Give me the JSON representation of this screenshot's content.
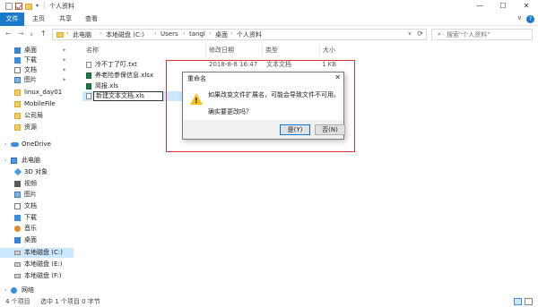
{
  "window": {
    "title": "个人资料",
    "title_sep": "|",
    "controls": {
      "minimize": "—",
      "maximize": "☐",
      "close": "✕"
    }
  },
  "ribbon": {
    "tabs": [
      "文件",
      "主页",
      "共享",
      "查看"
    ],
    "expand": "∨"
  },
  "nav": {
    "back": "←",
    "forward": "→",
    "recent": "∨",
    "up": "↑"
  },
  "address": {
    "crumbs": [
      "此电脑",
      "本地磁盘 (C:)",
      "Users",
      "tangl",
      "桌面",
      "个人资料"
    ],
    "sep": "›",
    "dropdown": "∨",
    "refresh": "⟳"
  },
  "search": {
    "icon": "⌕",
    "placeholder": "搜索\"个人资料\""
  },
  "sidebar": {
    "items": [
      {
        "label": "桌面",
        "icon": "desktop-icon",
        "pinned": true
      },
      {
        "label": "下载",
        "icon": "download-icon",
        "pinned": true
      },
      {
        "label": "文档",
        "icon": "document-icon",
        "pinned": true
      },
      {
        "label": "图片",
        "icon": "picture-icon",
        "pinned": true
      },
      {
        "label": "linux_day01",
        "icon": "folder-icon",
        "pinned": false
      },
      {
        "label": "MobileFile",
        "icon": "folder-icon",
        "pinned": false
      },
      {
        "label": "公司局",
        "icon": "folder-icon",
        "pinned": false
      },
      {
        "label": "资源",
        "icon": "folder-icon",
        "pinned": false
      },
      {
        "label": "OneDrive",
        "icon": "onedrive-icon",
        "pinned": false
      },
      {
        "label": "此电脑",
        "icon": "this-pc-icon",
        "pinned": false
      },
      {
        "label": "3D 对象",
        "icon": "3d-objects-icon",
        "pinned": false
      },
      {
        "label": "视频",
        "icon": "video-icon",
        "pinned": false
      },
      {
        "label": "图片",
        "icon": "picture-icon",
        "pinned": false
      },
      {
        "label": "文档",
        "icon": "document-icon",
        "pinned": false
      },
      {
        "label": "下载",
        "icon": "download-icon",
        "pinned": false
      },
      {
        "label": "音乐",
        "icon": "music-icon",
        "pinned": false
      },
      {
        "label": "桌面",
        "icon": "desktop-icon",
        "pinned": false
      },
      {
        "label": "本地磁盘 (C:)",
        "icon": "drive-icon",
        "pinned": false
      },
      {
        "label": "本地磁盘 (E:)",
        "icon": "drive-icon",
        "pinned": false
      },
      {
        "label": "本地磁盘 (F:)",
        "icon": "drive-icon",
        "pinned": false
      },
      {
        "label": "网络",
        "icon": "network-icon",
        "pinned": false
      }
    ],
    "pin_glyph": "✦",
    "expand_glyph": "›"
  },
  "columns": {
    "name": "名称",
    "date": "修改日期",
    "type": "类型",
    "size": "大小"
  },
  "files": [
    {
      "name": "冷不丁了叮.txt",
      "date": "2018-8-8 16:47",
      "type": "文本文档",
      "size": "1 KB",
      "icon": "text-file-icon"
    },
    {
      "name": "养老险参保信息.xlsx",
      "date": "",
      "type": "",
      "size": "",
      "icon": "excel-file-icon"
    },
    {
      "name": "简报.xls",
      "date": "",
      "type": "",
      "size": "",
      "icon": "excel-file-icon"
    },
    {
      "name": "新建文本文档.xls",
      "date": "",
      "type": "",
      "size": "",
      "icon": "text-file-icon",
      "editing": true
    }
  ],
  "dialog": {
    "title": "重命名",
    "close": "✕",
    "message1": "如果改变文件扩展名，可能会导致文件不可用。",
    "message2": "确实要更改吗？",
    "yes": "是(Y)",
    "no": "否(N)",
    "warning_mark": "!"
  },
  "status": {
    "count": "4 个项目",
    "selected": "选中 1 个项目 0 字节"
  },
  "colors": {
    "accent": "#1979ca",
    "selection": "#cce8ff",
    "annotation_red": "#e03131",
    "warning": "#f4c21b"
  }
}
